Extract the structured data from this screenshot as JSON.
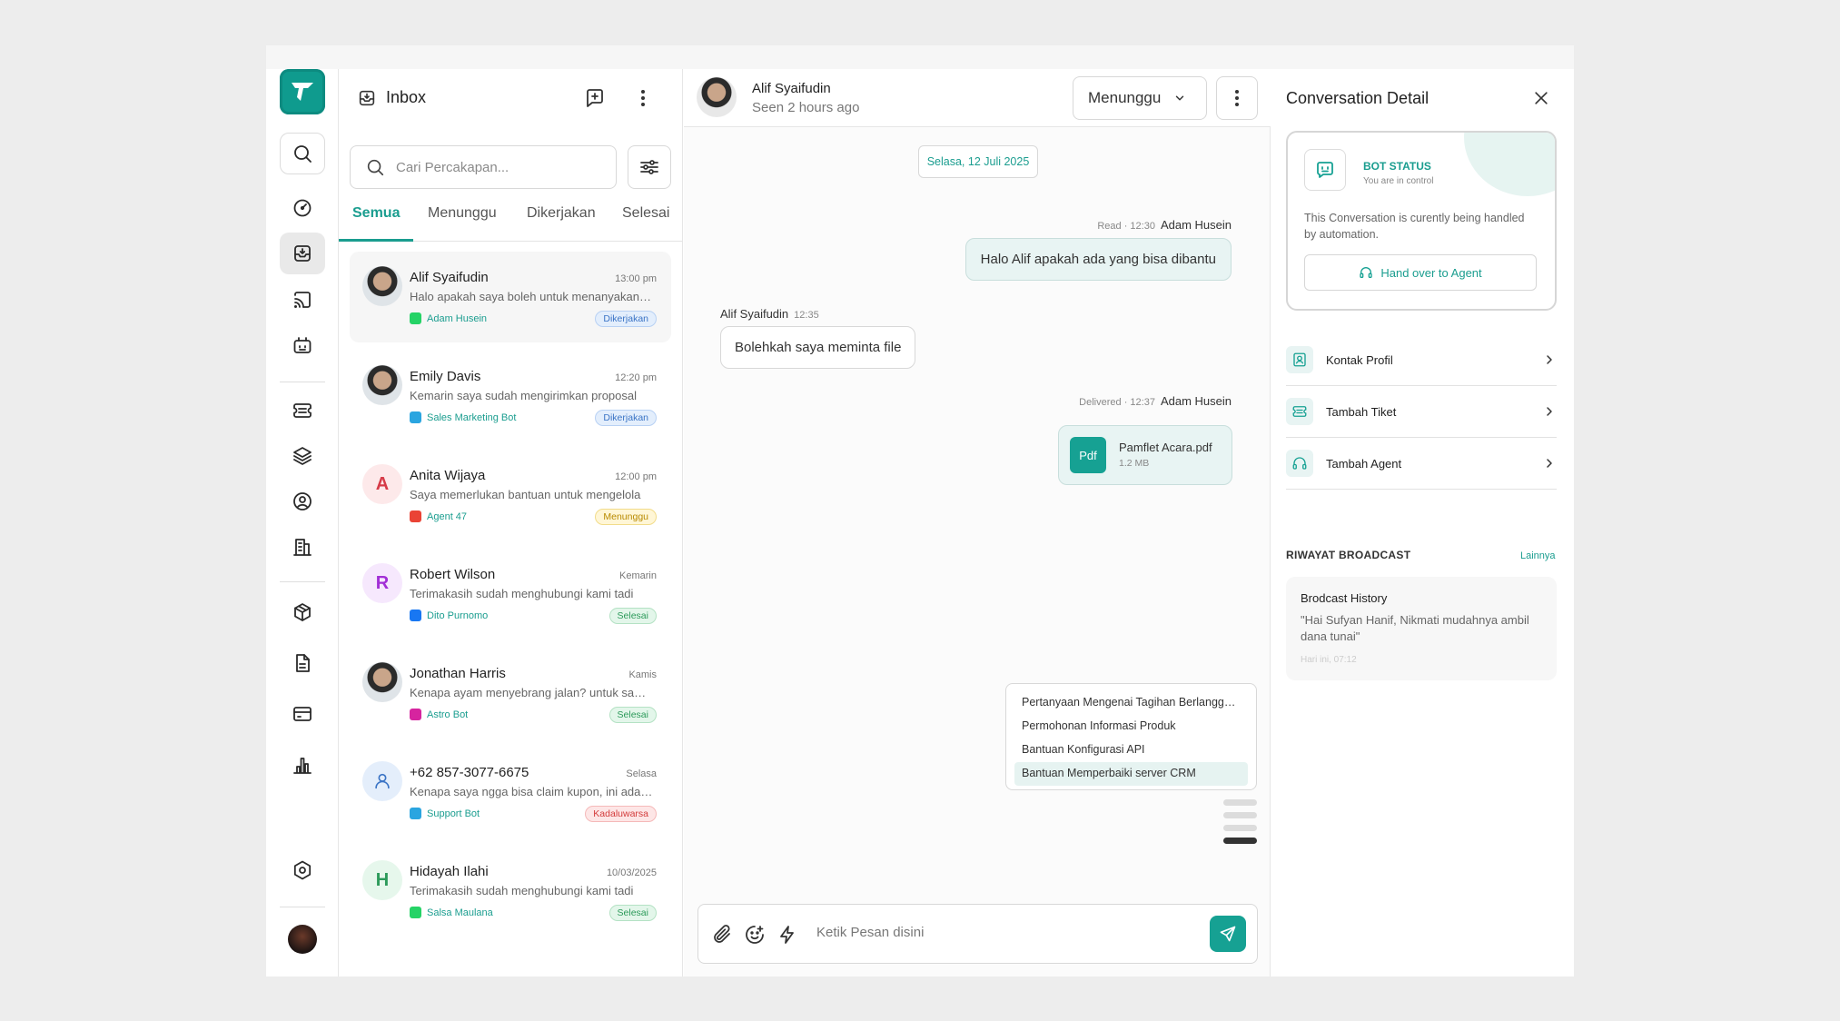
{
  "rail": {
    "icons": [
      "search-icon",
      "dashboard-icon",
      "inbox-icon",
      "broadcast-icon",
      "bot-icon",
      "ticket-icon",
      "layers-icon",
      "contact-icon",
      "building-icon",
      "package-icon",
      "document-icon",
      "billing-icon",
      "analytics-icon",
      "settings-icon"
    ]
  },
  "inbox": {
    "title": "Inbox",
    "search_placeholder": "Cari Percakapan...",
    "tabs": [
      "Semua",
      "Menunggu",
      "Dikerjakan",
      "Selesai"
    ],
    "conversations": [
      {
        "name": "Alif Syaifudin",
        "time": "13:00 pm",
        "message": "Halo apakah saya boleh untuk menanyakan sesuatu",
        "channel": "Adam Husein",
        "channel_icon": "whatsapp-icon",
        "status": "Dikerjakan",
        "status_type": "kerja",
        "avatar": "photo",
        "selected": true
      },
      {
        "name": "Emily Davis",
        "time": "12:20 pm",
        "message": "Kemarin saya sudah mengirimkan proposal",
        "channel": "Sales Marketing Bot",
        "channel_icon": "telegram-icon",
        "status": "Dikerjakan",
        "status_type": "kerja",
        "avatar": "photo"
      },
      {
        "name": "Anita Wijaya",
        "time": "12:00 pm",
        "message": "Saya memerlukan bantuan untuk mengelola",
        "channel": "Agent 47",
        "channel_icon": "gmail-icon",
        "status": "Menunggu",
        "status_type": "tunggu",
        "avatar": "letter",
        "letter": "A"
      },
      {
        "name": "Robert Wilson",
        "time": "Kemarin",
        "message": "Terimakasih sudah menghubungi kami tadi",
        "channel": "Dito Purnomo",
        "channel_icon": "facebook-icon",
        "status": "Selesai",
        "status_type": "selesai",
        "avatar": "letter",
        "letter": "R"
      },
      {
        "name": "Jonathan Harris",
        "time": "Kamis",
        "message": "Kenapa ayam menyebrang jalan? untuk sampai",
        "channel": "Astro Bot",
        "channel_icon": "instagram-icon",
        "status": "Selesai",
        "status_type": "selesai",
        "avatar": "photo"
      },
      {
        "name": "+62 857-3077-6675",
        "time": "Selasa",
        "message": "Kenapa saya ngga bisa claim kupon, ini ada apa",
        "channel": "Support Bot",
        "channel_icon": "telegram-icon",
        "status": "Kadaluwarsa",
        "status_type": "kada",
        "avatar": "user"
      },
      {
        "name": "Hidayah Ilahi",
        "time": "10/03/2025",
        "message": "Terimakasih sudah menghubungi kami tadi",
        "channel": "Salsa Maulana",
        "channel_icon": "whatsapp-icon",
        "status": "Selesai",
        "status_type": "selesai",
        "avatar": "letter",
        "letter": "H"
      }
    ]
  },
  "chat": {
    "contact_name": "Alif Syaifudin",
    "seen": "Seen 2 hours ago",
    "status_select": "Menunggu",
    "date_chip": "Selasa, 12 Juli 2025",
    "messages": [
      {
        "meta": "Read · 12:30",
        "author": "Adam Husein",
        "text": "Halo Alif apakah ada yang bisa dibantu"
      },
      {
        "author": "Alif Syaifudin",
        "meta": "12:35",
        "text": "Bolehkah saya meminta file"
      },
      {
        "meta": "Delivered · 12:37",
        "author": "Adam Husein",
        "file_type": "Pdf",
        "file_name": "Pamflet Acara.pdf",
        "file_size": "1.2 MB"
      }
    ],
    "quick_replies": [
      "Pertanyaan Mengenai Tagihan Berlangganan",
      "Permohonan Informasi Produk",
      "Bantuan Konfigurasi API",
      "Bantuan Memperbaiki server CRM"
    ],
    "composer_placeholder": "Ketik Pesan disini"
  },
  "detail": {
    "title": "Conversation Detail",
    "bot_status_title": "BOT STATUS",
    "bot_status_sub": "You are in control",
    "bot_desc": "This Conversation is curently being handled by automation.",
    "hand_over": "Hand over to Agent",
    "rows": [
      "Kontak Profil",
      "Tambah Tiket",
      "Tambah Agent"
    ],
    "broadcast_heading": "RIWAYAT BROADCAST",
    "more": "Lainnya",
    "broadcast_title": "Brodcast History",
    "broadcast_msg": "\"Hai Sufyan Hanif, Nikmati mudahnya ambil dana tunai\"",
    "broadcast_date": "Hari ini, 07:12"
  },
  "colors": {
    "accent": "#16a193",
    "selected_bg": "#f6f6f6"
  }
}
